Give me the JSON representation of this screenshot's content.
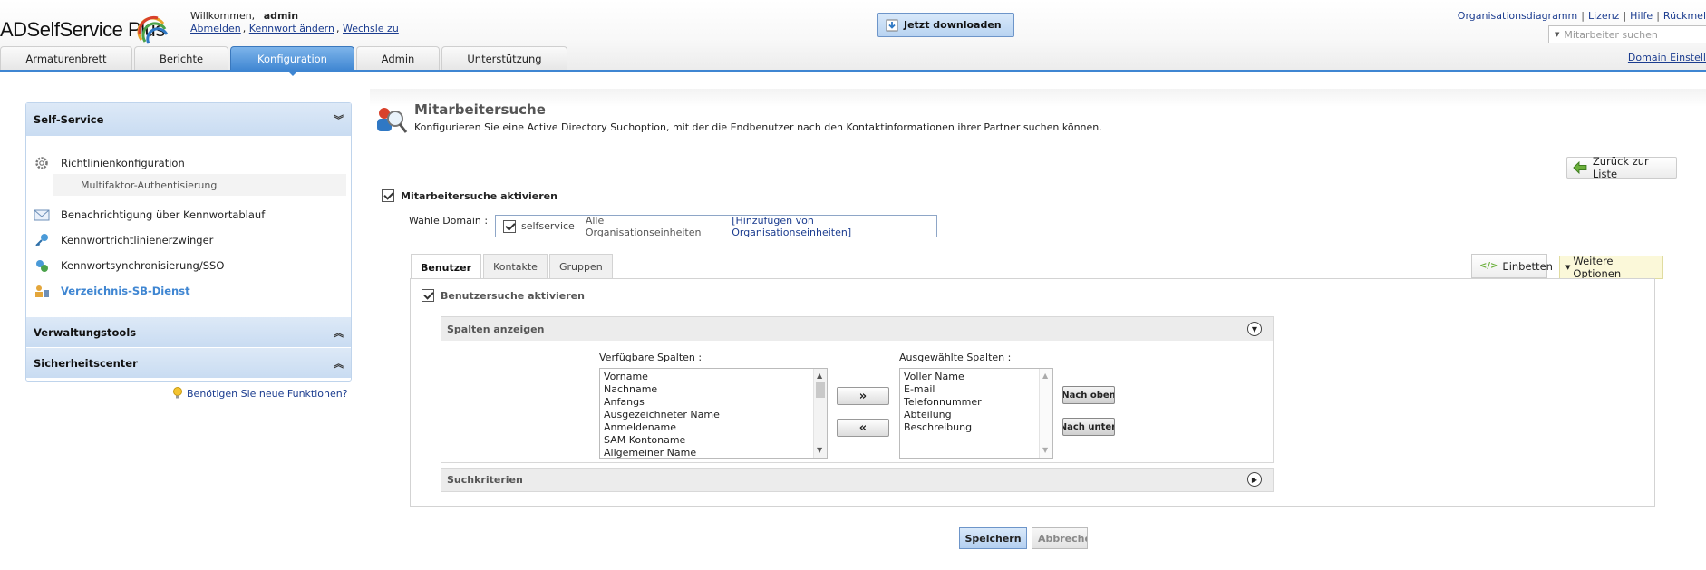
{
  "header": {
    "logo_text": "ADSelfService Plus",
    "welcome_prefix": "Willkommen,",
    "username": "admin",
    "links": [
      "Abmelden",
      "Kennwort ändern",
      "Wechsle zu"
    ],
    "download_label": "Jetzt downloaden",
    "top_links": [
      "Organisationsdiagramm",
      "Lizenz",
      "Hilfe",
      "Rückmel"
    ],
    "employee_search_placeholder": "Mitarbeiter suchen",
    "domain_settings": "Domain Einstell",
    "tabs": [
      "Armaturenbrett",
      "Berichte",
      "Konfiguration",
      "Admin",
      "Unterstützung"
    ],
    "active_tab": "Konfiguration"
  },
  "sidebar": {
    "section_self_service": "Self-Service",
    "items": [
      {
        "label": "Richtlinienkonfiguration",
        "icon": "gear-icon"
      },
      {
        "label": "Multifaktor-Authentisierung",
        "icon": ""
      },
      {
        "label": "Benachrichtigung über Kennwortablauf",
        "icon": "envelope-icon"
      },
      {
        "label": "Kennwortrichtlinienerzwinger",
        "icon": "key-icon"
      },
      {
        "label": "Kennwortsynchronisierung/SSO",
        "icon": "sync-icon"
      },
      {
        "label": "Verzeichnis-SB-Dienst",
        "icon": "directory-icon"
      }
    ],
    "section_admin_tools": "Verwaltungstools",
    "section_security": "Sicherheitscenter",
    "feature_link": "Benötigen Sie neue Funktionen?"
  },
  "main": {
    "title": "Mitarbeitersuche",
    "description": "Konfigurieren Sie eine Active Directory Suchoption, mit der die Endbenutzer nach den Kontaktinformationen ihrer Partner suchen können.",
    "back_button": "Zurück zur Liste",
    "enable_label": "Mitarbeitersuche aktivieren",
    "enable_checked": true,
    "domain_label": "Wähle Domain :",
    "domain_name": "selfservice",
    "domain_ou": "Alle Organisationseinheiten",
    "domain_add": "[Hinzufügen von Organisationseinheiten]",
    "subtabs": [
      "Benutzer",
      "Kontakte",
      "Gruppen"
    ],
    "active_subtab": "Benutzer",
    "embed_button": "Einbetten",
    "more_options": "Weitere Optionen",
    "user_search_label": "Benutzersuche aktivieren",
    "columns_panel_title": "Spalten anzeigen",
    "available_label": "Verfügbare Spalten :",
    "available_columns": [
      "Vorname",
      "Nachname",
      "Anfangs",
      "Ausgezeichneter Name",
      "Anmeldename",
      "SAM Kontoname",
      "Allgemeiner Name"
    ],
    "selected_label": "Ausgewählte Spalten :",
    "selected_columns": [
      "Voller Name",
      "E-mail",
      "Telefonnummer",
      "Abteilung",
      "Beschreibung"
    ],
    "add_button": "»",
    "remove_button": "«",
    "move_up": "Nach oben",
    "move_down": "Nach unten",
    "criteria_panel_title": "Suchkriterien",
    "save_button": "Speichern",
    "cancel_button": "Abbrechen"
  },
  "colors": {
    "accent_blue": "#3f86d2",
    "link_blue": "#1b3c8f",
    "sidebar_header": "#c9dcf2"
  }
}
